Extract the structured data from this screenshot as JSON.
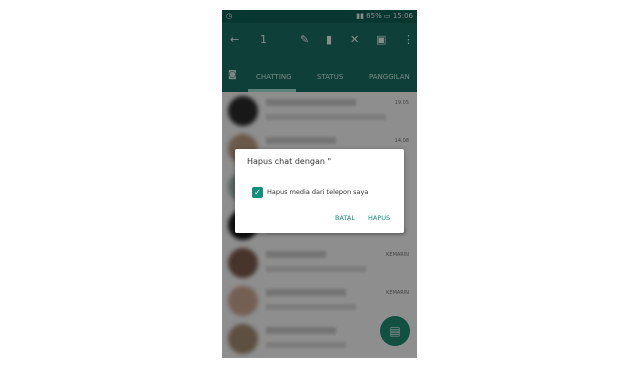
{
  "status_bar": {
    "left_icon": "whatsapp-notification-icon",
    "battery_percent": "65%",
    "time": "15:06",
    "icons": [
      "sim-icon",
      "wifi-icon",
      "signal-icon"
    ]
  },
  "toolbar": {
    "selected_count": "1",
    "back_glyph": "←",
    "actions": {
      "pin": "pin-icon",
      "delete": "trash-icon",
      "mute": "mute-icon",
      "archive": "archive-icon",
      "more": "more-icon"
    }
  },
  "tabs": [
    {
      "label": "CHATTING"
    },
    {
      "label": "STATUS"
    },
    {
      "label": "PANGGILAN"
    }
  ],
  "chat_list": {
    "times": [
      "19.05",
      "14.08",
      "",
      "",
      "KEMARIN",
      "KEMARIN",
      ""
    ]
  },
  "dialog": {
    "title": "Hapus chat dengan \"",
    "checkbox_label": "Hapus media dari telepon saya",
    "checkbox_checked": true,
    "cancel_label": "BATAL",
    "confirm_label": "HAPUS"
  },
  "colors": {
    "primary": "#1b6d63",
    "primary_dark": "#0f5d54",
    "accent": "#138f7a"
  }
}
